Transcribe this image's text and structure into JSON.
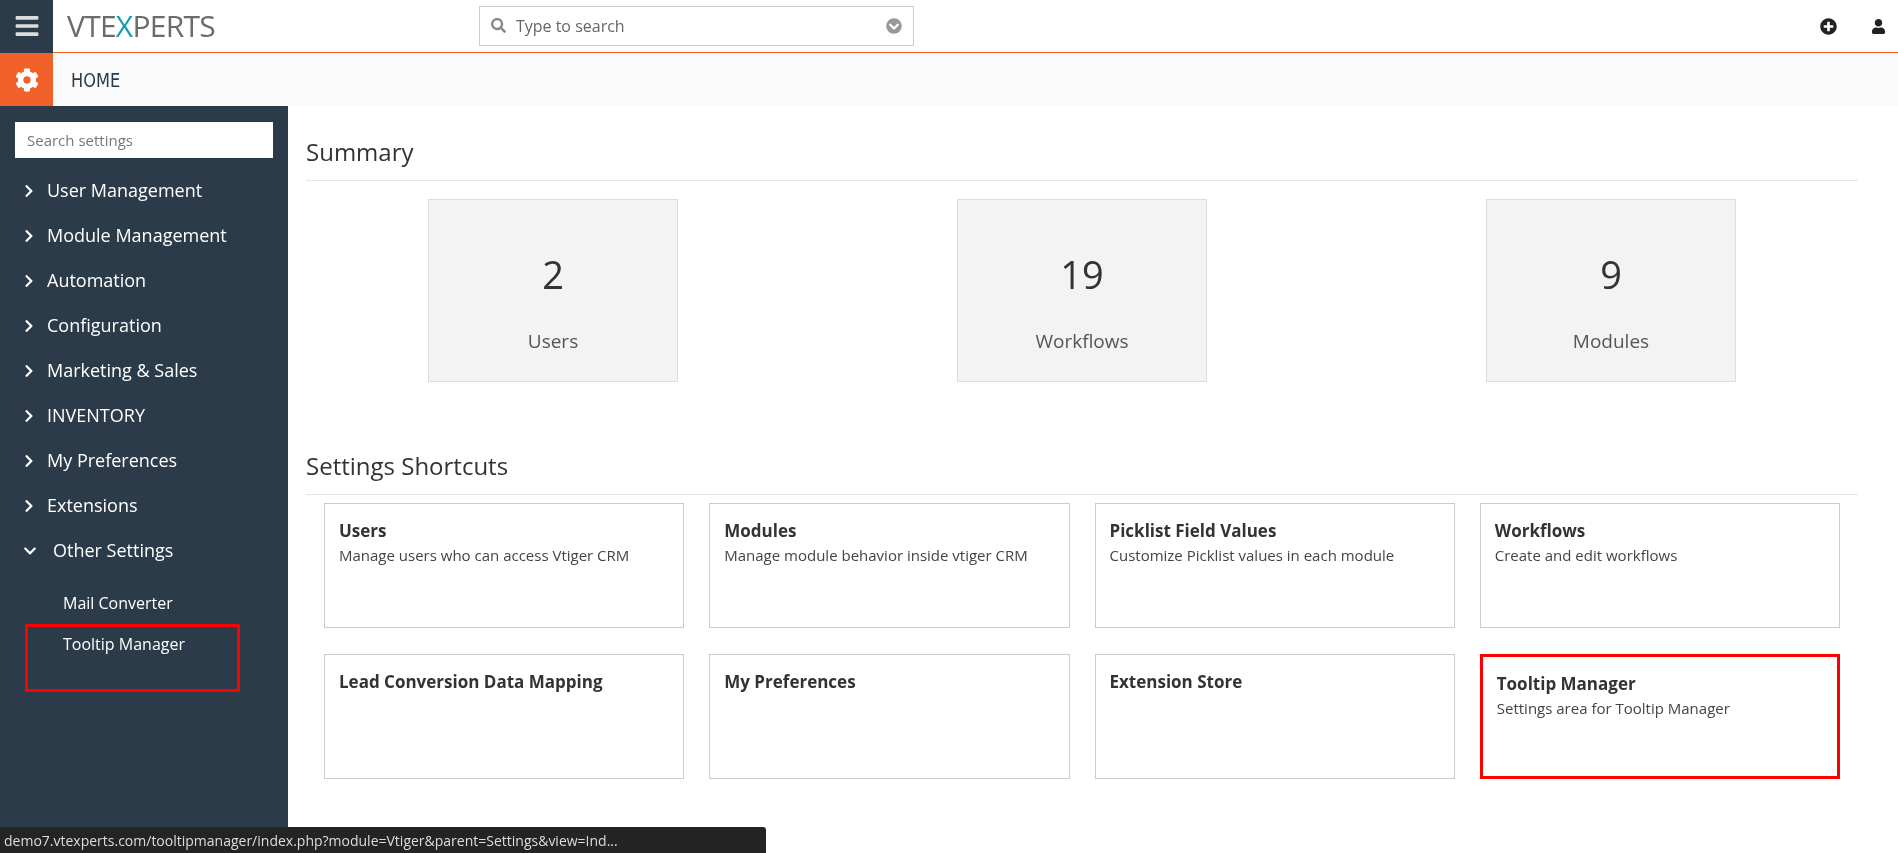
{
  "topbar": {
    "logo": [
      {
        "text": "VTE",
        "color": "#6b6b6b"
      },
      {
        "text": "X",
        "color": "#1a9bb5"
      },
      {
        "text": "PERTS",
        "color": "#6b6b6b"
      }
    ],
    "search": {
      "placeholder": "Type to search"
    }
  },
  "breadcrumb": {
    "title": "HOME"
  },
  "sidebar": {
    "search": {
      "placeholder": "Search settings"
    },
    "items": [
      {
        "label": "User Management",
        "expanded": false
      },
      {
        "label": "Module Management",
        "expanded": false
      },
      {
        "label": "Automation",
        "expanded": false
      },
      {
        "label": "Configuration",
        "expanded": false
      },
      {
        "label": "Marketing & Sales",
        "expanded": false
      },
      {
        "label": "INVENTORY",
        "expanded": false
      },
      {
        "label": "My Preferences",
        "expanded": false
      },
      {
        "label": "Extensions",
        "expanded": false
      },
      {
        "label": "Other Settings",
        "expanded": true,
        "children": [
          {
            "label": "Mail Converter",
            "highlighted": false
          },
          {
            "label": "Tooltip Manager",
            "highlighted": true
          }
        ]
      }
    ]
  },
  "summary": {
    "title": "Summary",
    "cards": [
      {
        "value": "2",
        "label": "Users"
      },
      {
        "value": "19",
        "label": "Workflows"
      },
      {
        "value": "9",
        "label": "Modules"
      }
    ]
  },
  "shortcuts": {
    "title": "Settings Shortcuts",
    "cards": [
      {
        "title": "Users",
        "description": "Manage users who can access Vtiger CRM",
        "highlighted": false
      },
      {
        "title": "Modules",
        "description": "Manage module behavior inside vtiger CRM",
        "highlighted": false
      },
      {
        "title": "Picklist Field Values",
        "description": "Customize Picklist values in each module",
        "highlighted": false
      },
      {
        "title": "Workflows",
        "description": "Create and edit workflows",
        "highlighted": false
      },
      {
        "title": "Lead Conversion Data Mapping",
        "highlighted": false
      },
      {
        "title": "My Preferences",
        "highlighted": false
      },
      {
        "title": "Extension Store",
        "highlighted": false
      },
      {
        "title": "Tooltip Manager",
        "description": "Settings area for Tooltip Manager",
        "highlighted": true
      }
    ]
  },
  "status_bar": {
    "url": "demo7.vtexperts.com/tooltipmanager/index.php?module=Vtiger&parent=Settings&view=Ind..."
  }
}
